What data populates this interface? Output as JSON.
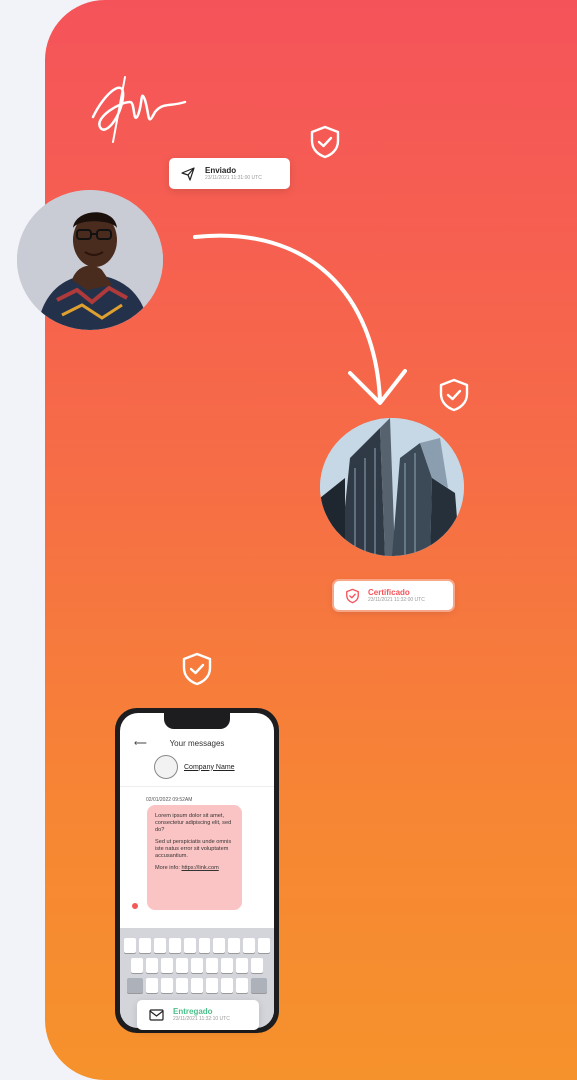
{
  "sent_card": {
    "title": "Enviado",
    "time": "23/11/2021 11:31:00 UTC",
    "icon": "paper-plane-icon"
  },
  "certified_card": {
    "title": "Certificado",
    "time": "23/11/2021 11:32:00 UTC",
    "icon": "shield-check-icon",
    "color": "#f5535a"
  },
  "delivered_card": {
    "title": "Entregado",
    "time": "23/11/2021 11:32:10 UTC",
    "icon": "envelope-icon",
    "color": "#4cc08a"
  },
  "phone": {
    "header": "Your messages",
    "company": "Company Name",
    "timestamp": "02/01/2022  09:52AM",
    "message_p1": "Lorem ipsum dolor sit amet, consectetur adipiscing elit, sed do?",
    "message_p2": "Sed ut perspiciatis unde omnis iste natus error sit voluptatem accusantium.",
    "more_info": "More info:",
    "link": "https://link.com"
  },
  "colors": {
    "gradient_top": "#f5535a",
    "gradient_bottom": "#f6922c"
  }
}
